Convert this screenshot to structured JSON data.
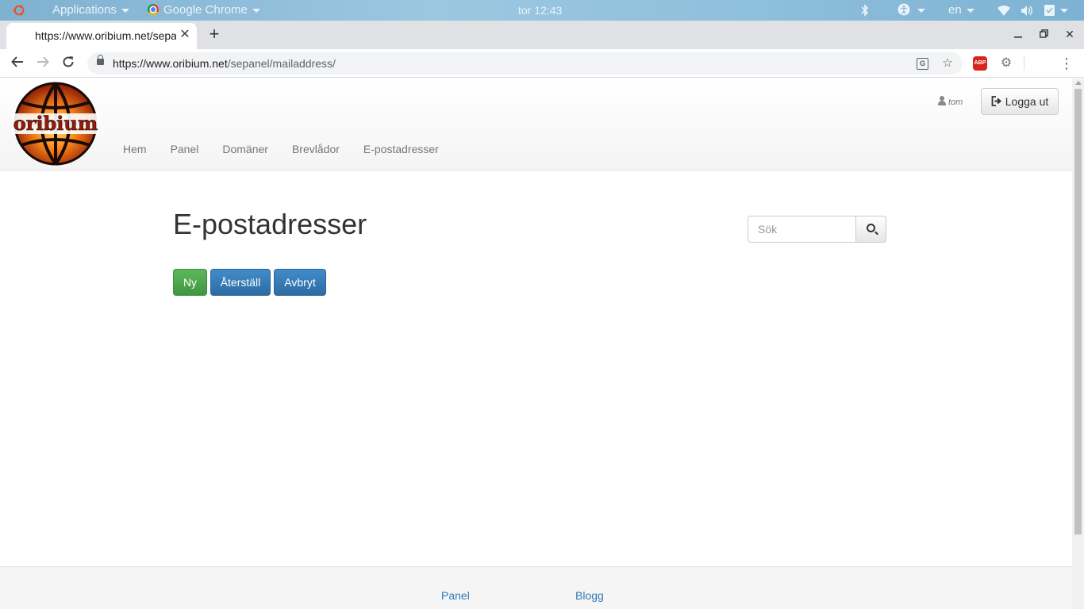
{
  "os_bar": {
    "applications_label": "Applications",
    "active_app_label": "Google Chrome",
    "clock": "tor 12:43",
    "language": "en"
  },
  "browser": {
    "tab_title": "https://www.oribium.net/sepanel/mailaddress/",
    "new_tab_symbol": "+",
    "url_host": "https://www.oribium.net",
    "url_path": "/sepanel/mailaddress/",
    "extension_abp": "ABP"
  },
  "site": {
    "logo_text": "oribium",
    "nav": [
      "Hem",
      "Panel",
      "Domäner",
      "Brevlådor",
      "E-postadresser"
    ],
    "username": "tom",
    "logout_label": "Logga ut"
  },
  "main": {
    "title": "E-postadresser",
    "search_placeholder": "Sök",
    "buttons": {
      "new": "Ny",
      "reset": "Återställ",
      "cancel": "Avbryt"
    }
  },
  "footer": {
    "links": [
      "Panel",
      "Blogg"
    ]
  },
  "colors": {
    "success": "#5cb85c",
    "primary": "#428bca",
    "link": "#337ab7"
  }
}
